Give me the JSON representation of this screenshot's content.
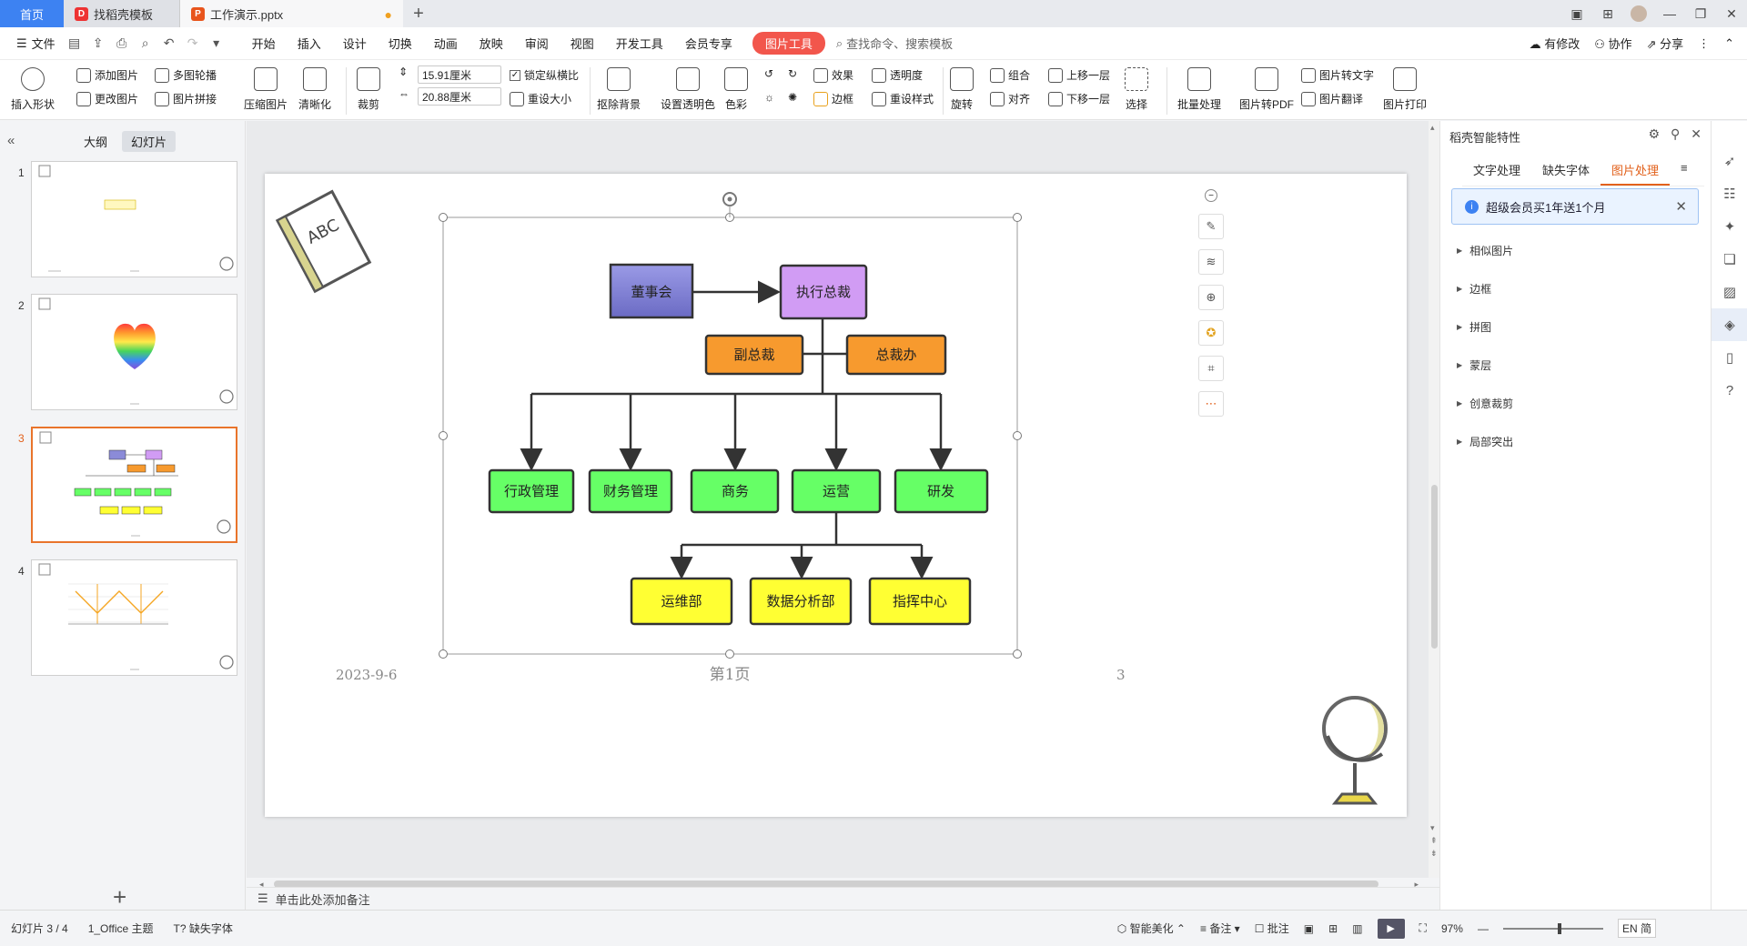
{
  "titlebar": {
    "home_tab": "首页",
    "template_tab": "找稻壳模板",
    "file_tab": "工作演示.pptx",
    "unsaved_dot": "●"
  },
  "menu": {
    "file_label": "文件",
    "items": [
      "开始",
      "插入",
      "设计",
      "切换",
      "动画",
      "放映",
      "审阅",
      "视图",
      "开发工具",
      "会员专享"
    ],
    "active_tool": "图片工具",
    "search_placeholder": "查找命令、搜索模板",
    "right": {
      "modified": "有修改",
      "collab": "协作",
      "share": "分享"
    }
  },
  "ribbon": {
    "insert_shape": "插入形状",
    "add_image": "添加图片",
    "multi_carousel": "多图轮播",
    "change_image": "更改图片",
    "image_stitch": "图片拼接",
    "compress": "压缩图片",
    "sharpen": "清晰化",
    "crop": "裁剪",
    "width_value": "15.91厘米",
    "height_value": "20.88厘米",
    "lock_ratio": "锁定纵横比",
    "reset_size": "重设大小",
    "remove_bg": "抠除背景",
    "set_transparent": "设置透明色",
    "color": "色彩",
    "effects": "效果",
    "transparency": "透明度",
    "border": "边框",
    "reset_style": "重设样式",
    "rotate": "旋转",
    "group": "组合",
    "align": "对齐",
    "bring_forward": "上移一层",
    "send_backward": "下移一层",
    "select": "选择",
    "batch": "批量处理",
    "to_pdf": "图片转PDF",
    "to_text": "图片转文字",
    "translate": "图片翻译",
    "print": "图片打印"
  },
  "left_panel": {
    "tab_outline": "大纲",
    "tab_slides": "幻灯片",
    "slides": [
      {
        "num": "1",
        "selected": false
      },
      {
        "num": "2",
        "selected": false
      },
      {
        "num": "3",
        "selected": true
      },
      {
        "num": "4",
        "selected": false
      }
    ]
  },
  "slide": {
    "date": "2023-9-6",
    "page_label": "第1页",
    "page_number": "3",
    "org": {
      "board": "董事会",
      "ceo": "执行总裁",
      "vp": "副总裁",
      "office": "总裁办",
      "depts": [
        "行政管理",
        "财务管理",
        "商务",
        "运营",
        "研发"
      ],
      "subs": [
        "运维部",
        "数据分析部",
        "指挥中心"
      ]
    },
    "colors": {
      "board": "#8b8bd8",
      "ceo": "#d19cf4",
      "orange": "#f79a2e",
      "green": "#66ff66",
      "yellow": "#ffff33"
    }
  },
  "notes_placeholder": "单击此处添加备注",
  "right_panel": {
    "title": "稻壳智能特性",
    "tabs": [
      "文字处理",
      "缺失字体",
      "图片处理"
    ],
    "notice": "超级会员买1年送1个月",
    "sections": [
      "相似图片",
      "边框",
      "拼图",
      "蒙层",
      "创意裁剪",
      "局部突出"
    ]
  },
  "statusbar": {
    "slide_info": "幻灯片 3 / 4",
    "theme": "1_Office 主题",
    "missing_font": "缺失字体",
    "smart_beautify": "智能美化",
    "notes": "备注",
    "comments": "批注",
    "zoom": "97%",
    "ime": "EN 简"
  }
}
